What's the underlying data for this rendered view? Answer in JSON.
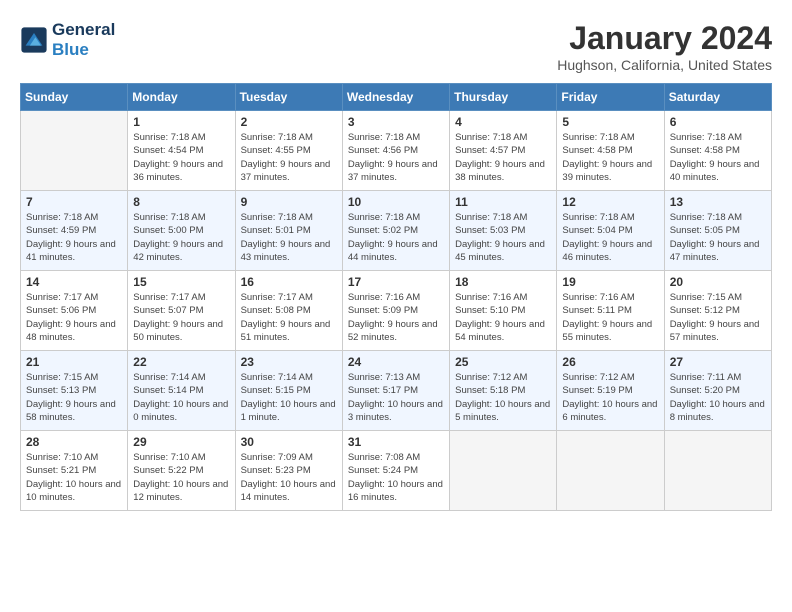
{
  "header": {
    "logo_line1": "General",
    "logo_line2": "Blue",
    "month_title": "January 2024",
    "location": "Hughson, California, United States"
  },
  "days_of_week": [
    "Sunday",
    "Monday",
    "Tuesday",
    "Wednesday",
    "Thursday",
    "Friday",
    "Saturday"
  ],
  "weeks": [
    [
      {
        "day": "",
        "empty": true
      },
      {
        "day": "1",
        "sunrise": "7:18 AM",
        "sunset": "4:54 PM",
        "daylight": "9 hours and 36 minutes."
      },
      {
        "day": "2",
        "sunrise": "7:18 AM",
        "sunset": "4:55 PM",
        "daylight": "9 hours and 37 minutes."
      },
      {
        "day": "3",
        "sunrise": "7:18 AM",
        "sunset": "4:56 PM",
        "daylight": "9 hours and 37 minutes."
      },
      {
        "day": "4",
        "sunrise": "7:18 AM",
        "sunset": "4:57 PM",
        "daylight": "9 hours and 38 minutes."
      },
      {
        "day": "5",
        "sunrise": "7:18 AM",
        "sunset": "4:58 PM",
        "daylight": "9 hours and 39 minutes."
      },
      {
        "day": "6",
        "sunrise": "7:18 AM",
        "sunset": "4:58 PM",
        "daylight": "9 hours and 40 minutes."
      }
    ],
    [
      {
        "day": "7",
        "sunrise": "7:18 AM",
        "sunset": "4:59 PM",
        "daylight": "9 hours and 41 minutes."
      },
      {
        "day": "8",
        "sunrise": "7:18 AM",
        "sunset": "5:00 PM",
        "daylight": "9 hours and 42 minutes."
      },
      {
        "day": "9",
        "sunrise": "7:18 AM",
        "sunset": "5:01 PM",
        "daylight": "9 hours and 43 minutes."
      },
      {
        "day": "10",
        "sunrise": "7:18 AM",
        "sunset": "5:02 PM",
        "daylight": "9 hours and 44 minutes."
      },
      {
        "day": "11",
        "sunrise": "7:18 AM",
        "sunset": "5:03 PM",
        "daylight": "9 hours and 45 minutes."
      },
      {
        "day": "12",
        "sunrise": "7:18 AM",
        "sunset": "5:04 PM",
        "daylight": "9 hours and 46 minutes."
      },
      {
        "day": "13",
        "sunrise": "7:18 AM",
        "sunset": "5:05 PM",
        "daylight": "9 hours and 47 minutes."
      }
    ],
    [
      {
        "day": "14",
        "sunrise": "7:17 AM",
        "sunset": "5:06 PM",
        "daylight": "9 hours and 48 minutes."
      },
      {
        "day": "15",
        "sunrise": "7:17 AM",
        "sunset": "5:07 PM",
        "daylight": "9 hours and 50 minutes."
      },
      {
        "day": "16",
        "sunrise": "7:17 AM",
        "sunset": "5:08 PM",
        "daylight": "9 hours and 51 minutes."
      },
      {
        "day": "17",
        "sunrise": "7:16 AM",
        "sunset": "5:09 PM",
        "daylight": "9 hours and 52 minutes."
      },
      {
        "day": "18",
        "sunrise": "7:16 AM",
        "sunset": "5:10 PM",
        "daylight": "9 hours and 54 minutes."
      },
      {
        "day": "19",
        "sunrise": "7:16 AM",
        "sunset": "5:11 PM",
        "daylight": "9 hours and 55 minutes."
      },
      {
        "day": "20",
        "sunrise": "7:15 AM",
        "sunset": "5:12 PM",
        "daylight": "9 hours and 57 minutes."
      }
    ],
    [
      {
        "day": "21",
        "sunrise": "7:15 AM",
        "sunset": "5:13 PM",
        "daylight": "9 hours and 58 minutes."
      },
      {
        "day": "22",
        "sunrise": "7:14 AM",
        "sunset": "5:14 PM",
        "daylight": "10 hours and 0 minutes."
      },
      {
        "day": "23",
        "sunrise": "7:14 AM",
        "sunset": "5:15 PM",
        "daylight": "10 hours and 1 minute."
      },
      {
        "day": "24",
        "sunrise": "7:13 AM",
        "sunset": "5:17 PM",
        "daylight": "10 hours and 3 minutes."
      },
      {
        "day": "25",
        "sunrise": "7:12 AM",
        "sunset": "5:18 PM",
        "daylight": "10 hours and 5 minutes."
      },
      {
        "day": "26",
        "sunrise": "7:12 AM",
        "sunset": "5:19 PM",
        "daylight": "10 hours and 6 minutes."
      },
      {
        "day": "27",
        "sunrise": "7:11 AM",
        "sunset": "5:20 PM",
        "daylight": "10 hours and 8 minutes."
      }
    ],
    [
      {
        "day": "28",
        "sunrise": "7:10 AM",
        "sunset": "5:21 PM",
        "daylight": "10 hours and 10 minutes."
      },
      {
        "day": "29",
        "sunrise": "7:10 AM",
        "sunset": "5:22 PM",
        "daylight": "10 hours and 12 minutes."
      },
      {
        "day": "30",
        "sunrise": "7:09 AM",
        "sunset": "5:23 PM",
        "daylight": "10 hours and 14 minutes."
      },
      {
        "day": "31",
        "sunrise": "7:08 AM",
        "sunset": "5:24 PM",
        "daylight": "10 hours and 16 minutes."
      },
      {
        "day": "",
        "empty": true
      },
      {
        "day": "",
        "empty": true
      },
      {
        "day": "",
        "empty": true
      }
    ]
  ],
  "labels": {
    "sunrise": "Sunrise:",
    "sunset": "Sunset:",
    "daylight": "Daylight:"
  }
}
